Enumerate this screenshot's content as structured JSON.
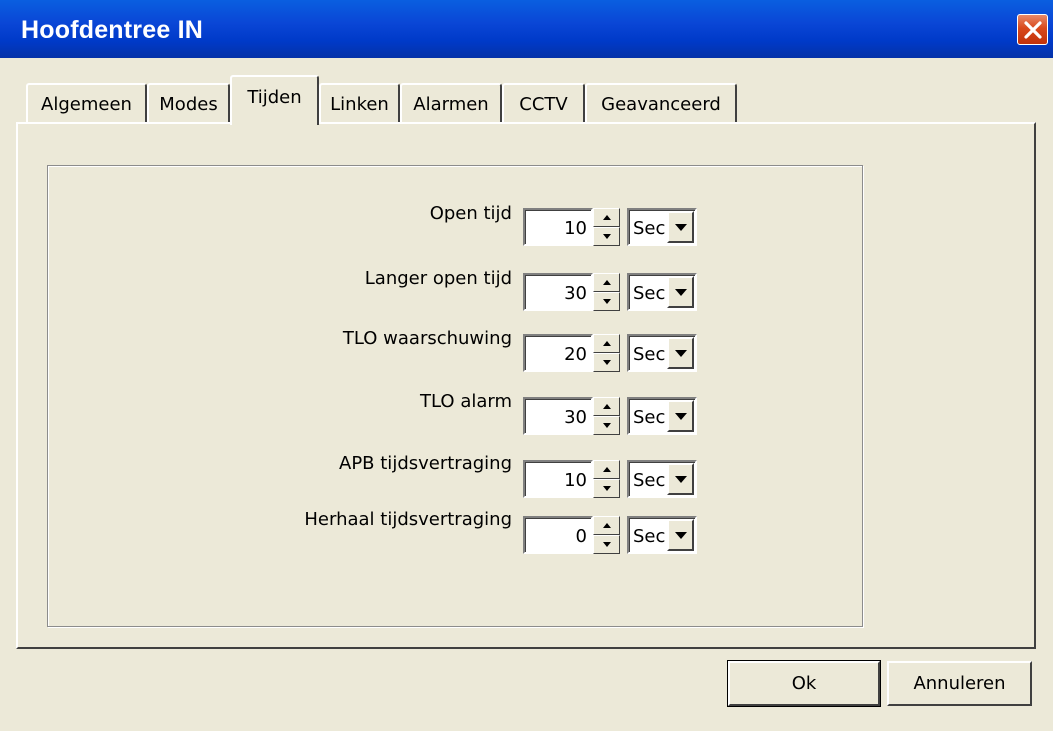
{
  "window": {
    "title": "Hoofdentree IN",
    "close_icon": "close-icon"
  },
  "tabs": [
    {
      "label": "Algemeen",
      "active": false
    },
    {
      "label": "Modes",
      "active": false
    },
    {
      "label": "Tijden",
      "active": true
    },
    {
      "label": "Linken",
      "active": false
    },
    {
      "label": "Alarmen",
      "active": false
    },
    {
      "label": "CCTV",
      "active": false
    },
    {
      "label": "Geavanceerd",
      "active": false
    }
  ],
  "fields": [
    {
      "label": "Open tijd",
      "value": "10",
      "unit": "Sec"
    },
    {
      "label": "Langer open tijd",
      "value": "30",
      "unit": "Sec"
    },
    {
      "label": "TLO waarschuwing",
      "value": "20",
      "unit": "Sec"
    },
    {
      "label": "TLO alarm",
      "value": "30",
      "unit": "Sec"
    },
    {
      "label": "APB tijdsvertraging",
      "value": "10",
      "unit": "Sec"
    },
    {
      "label": "Herhaal tijdsvertraging",
      "value": "0",
      "unit": "Sec"
    }
  ],
  "buttons": {
    "ok": "Ok",
    "cancel": "Annuleren"
  },
  "colors": {
    "titlebar": "#0a46d6",
    "dialog_bg": "#ece9d8",
    "close_button": "#d9491c"
  }
}
